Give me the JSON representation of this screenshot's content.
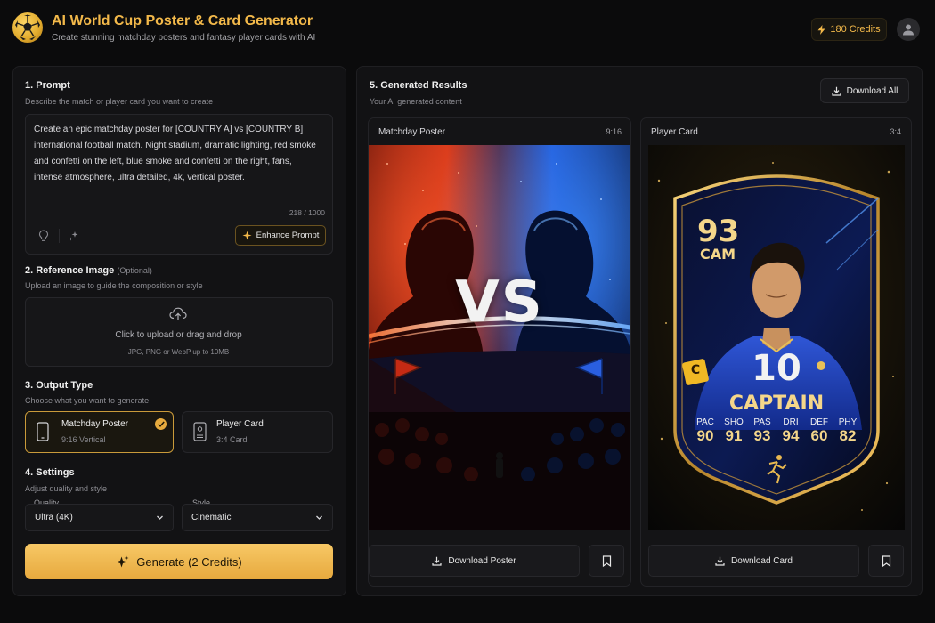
{
  "header": {
    "title": "AI World Cup Poster & Card Generator",
    "subtitle": "Create stunning matchday posters and fantasy player cards with AI",
    "credits": "180 Credits"
  },
  "prompt": {
    "title": "1. Prompt",
    "subtitle": "Describe the match or player card you want to create",
    "value": "Create an epic matchday poster for [COUNTRY A] vs [COUNTRY B] international football match. Night stadium, dramatic lighting, red smoke and confetti on the left, blue smoke and confetti on the right, fans, intense atmosphere, ultra detailed, 4k, vertical poster.",
    "counter": "218 / 1000",
    "enhance_label": "Enhance Prompt"
  },
  "reference": {
    "title": "2. Reference Image",
    "optional": "(Optional)",
    "subtitle": "Upload an image to guide the composition or style",
    "upload_text": "Click to upload or drag and drop",
    "upload_hint": "JPG, PNG or WebP up to 10MB"
  },
  "output": {
    "title": "3. Output Type",
    "subtitle": "Choose what you want to generate",
    "options": [
      {
        "title": "Matchday Poster",
        "sub": "9:16 Vertical",
        "selected": true
      },
      {
        "title": "Player Card",
        "sub": "3:4 Card",
        "selected": false
      }
    ]
  },
  "settings": {
    "title": "4. Settings",
    "subtitle": "Adjust quality and style",
    "quality_label": "Quality",
    "quality_value": "Ultra (4K)",
    "style_label": "Style",
    "style_value": "Cinematic"
  },
  "generate_label": "Generate (2 Credits)",
  "results": {
    "title": "5. Generated Results",
    "subtitle": "Your AI generated content",
    "download_all": "Download All",
    "poster": {
      "label": "Matchday Poster",
      "ratio": "9:16",
      "vs_text": "VS",
      "download": "Download Poster"
    },
    "card": {
      "label": "Player Card",
      "ratio": "3:4",
      "rating": "93",
      "position": "CAM",
      "number": "10",
      "armband": "C",
      "name": "CAPTAIN",
      "stats": [
        {
          "label": "PAC",
          "value": "90"
        },
        {
          "label": "SHO",
          "value": "91"
        },
        {
          "label": "PAS",
          "value": "93"
        },
        {
          "label": "DRI",
          "value": "94"
        },
        {
          "label": "DEF",
          "value": "60"
        },
        {
          "label": "PHY",
          "value": "82"
        }
      ],
      "download": "Download Card"
    }
  },
  "colors": {
    "accent": "#f3b94a",
    "red_team": "#d8321e",
    "blue_team": "#1f5fe6"
  }
}
